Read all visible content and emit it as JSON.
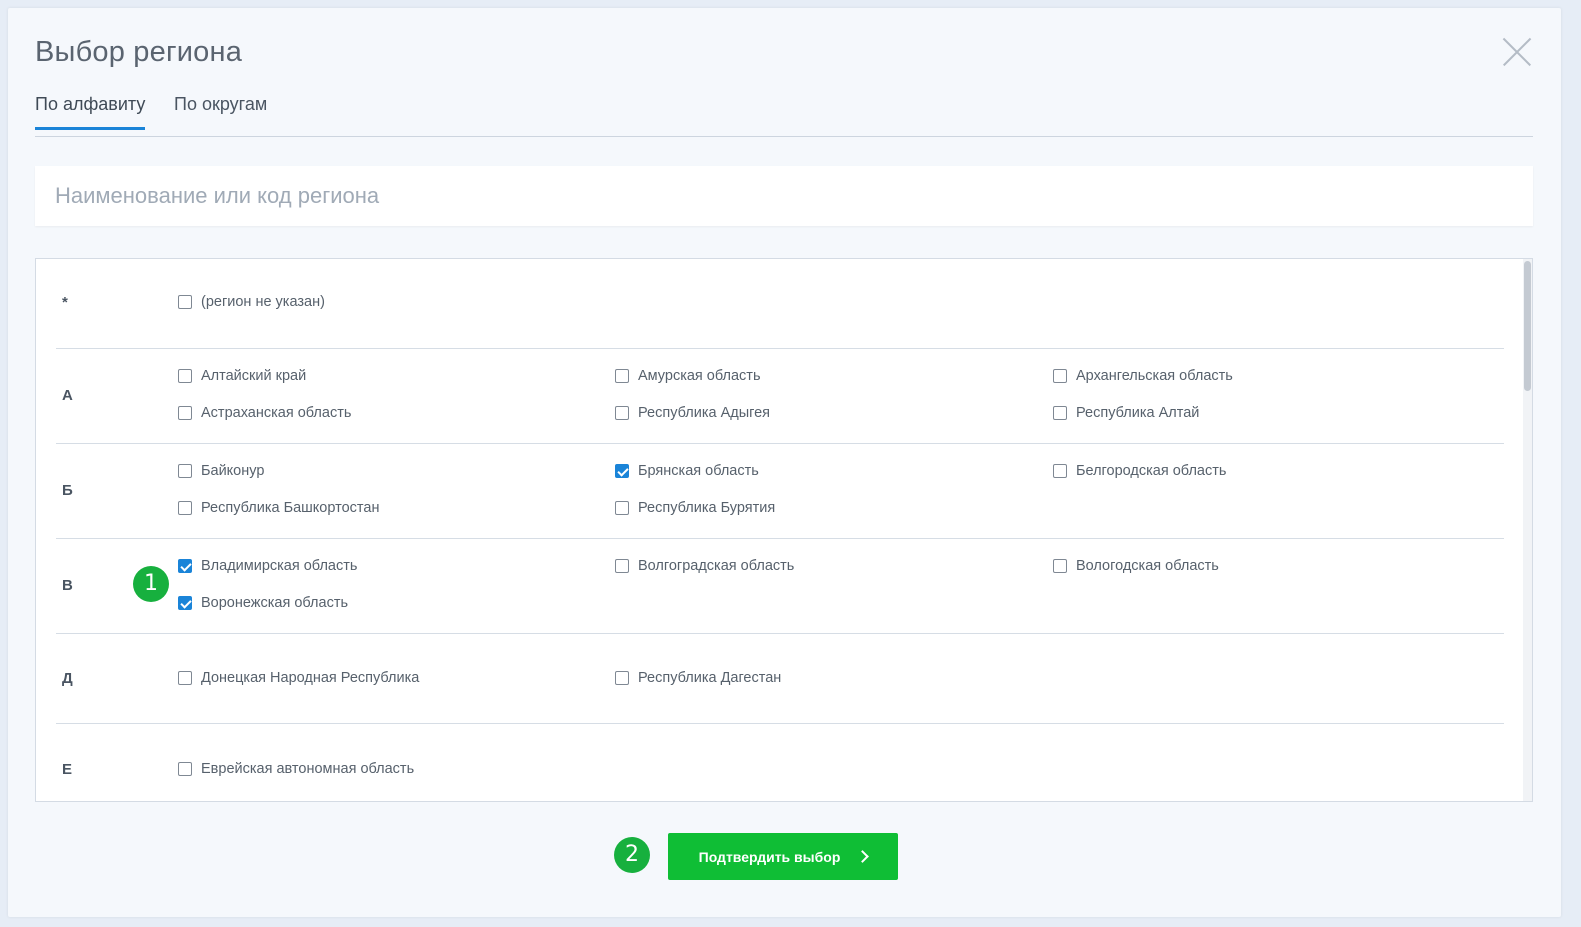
{
  "dialog": {
    "title": "Выбор региона"
  },
  "tabs": [
    {
      "label": "По алфавиту",
      "active": true
    },
    {
      "label": "По округам",
      "active": false
    }
  ],
  "search": {
    "placeholder": "Наименование или код региона",
    "value": ""
  },
  "groups": [
    {
      "letter": "*",
      "items": [
        {
          "label": "(регион не указан)",
          "checked": false
        }
      ]
    },
    {
      "letter": "А",
      "items": [
        {
          "label": "Алтайский край",
          "checked": false
        },
        {
          "label": "Амурская область",
          "checked": false
        },
        {
          "label": "Архангельская область",
          "checked": false
        },
        {
          "label": "Астраханская область",
          "checked": false
        },
        {
          "label": "Республика Адыгея",
          "checked": false
        },
        {
          "label": "Республика Алтай",
          "checked": false
        }
      ]
    },
    {
      "letter": "Б",
      "items": [
        {
          "label": "Байконур",
          "checked": false
        },
        {
          "label": "Брянская область",
          "checked": true
        },
        {
          "label": "Белгородская область",
          "checked": false
        },
        {
          "label": "Республика Башкортостан",
          "checked": false
        },
        {
          "label": "Республика Бурятия",
          "checked": false
        }
      ]
    },
    {
      "letter": "В",
      "items": [
        {
          "label": "Владимирская область",
          "checked": true
        },
        {
          "label": "Волгоградская область",
          "checked": false
        },
        {
          "label": "Вологодская область",
          "checked": false
        },
        {
          "label": "Воронежская область",
          "checked": true
        }
      ]
    },
    {
      "letter": "Д",
      "items": [
        {
          "label": "Донецкая Народная Республика",
          "checked": false
        },
        {
          "label": "Республика Дагестан",
          "checked": false
        }
      ]
    },
    {
      "letter": "Е",
      "items": [
        {
          "label": "Еврейская автономная область",
          "checked": false
        }
      ]
    }
  ],
  "annotations": {
    "step1": "1",
    "step2": "2"
  },
  "confirm_button": {
    "label": "Подтвердить выбор",
    "icon": "chevron-right-icon"
  },
  "colors": {
    "accent": "#1a84d8",
    "confirm": "#0fbe35",
    "badge": "#17b03e"
  }
}
